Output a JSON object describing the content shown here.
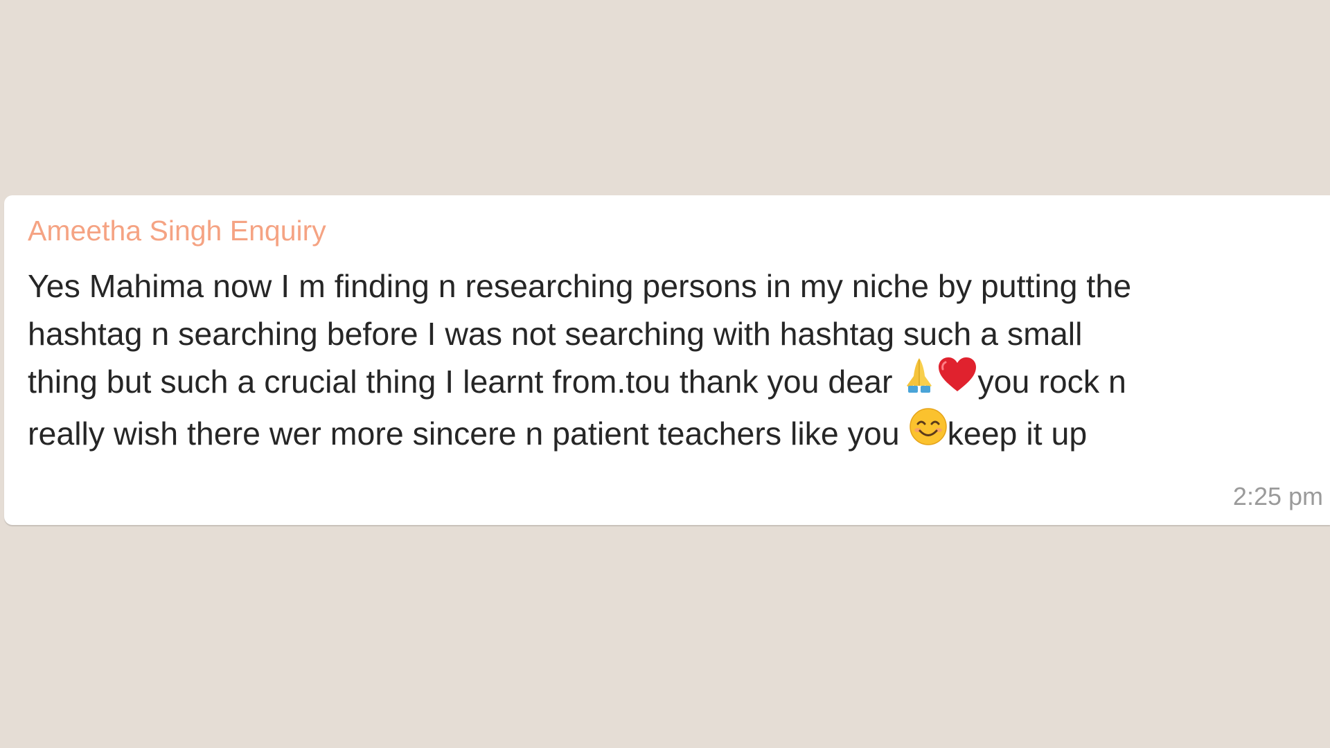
{
  "message": {
    "sender": "Ameetha Singh Enquiry",
    "lines": {
      "l1": "Yes Mahima now I m finding n researching persons in my niche by putting the",
      "l2": "hashtag n searching before I was not searching with hashtag such a small",
      "l3a": "thing but such a crucial thing I learnt from.tou thank you dear",
      "l3b": "you rock n",
      "l4a": "really wish there wer more sincere n patient teachers like you",
      "l4b": "keep it up"
    },
    "emojis": [
      "folded-hands-icon",
      "red-heart-icon",
      "smiling-face-icon"
    ],
    "timestamp": "2:25 pm"
  },
  "colors": {
    "background": "#e5ddd5",
    "bubble": "#ffffff",
    "sender_name": "#f5a383",
    "message_text": "#262626",
    "timestamp": "#9a9a9a"
  }
}
